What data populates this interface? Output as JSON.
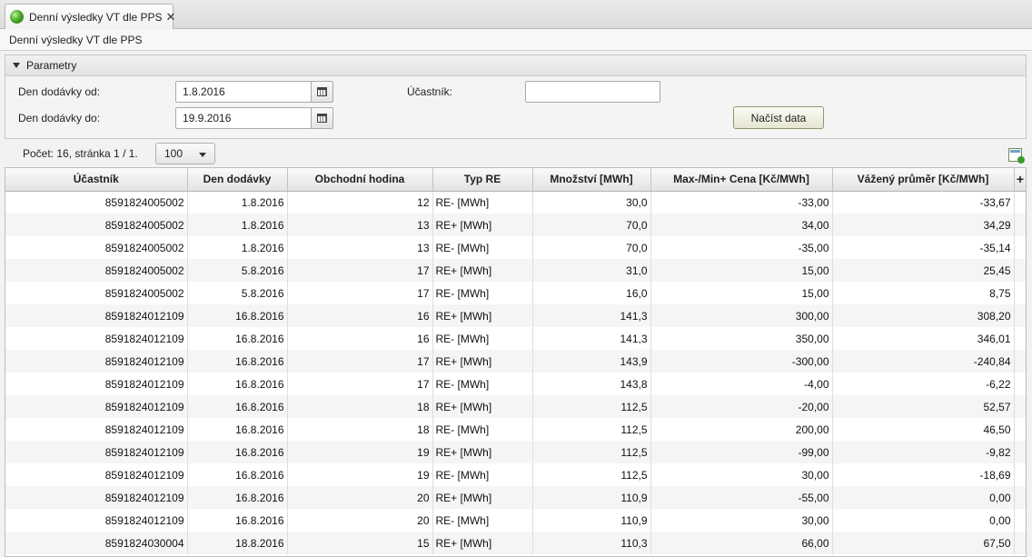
{
  "tab": {
    "title": "Denní výsledky VT dle PPS",
    "close": "✕"
  },
  "page_title": "Denní výsledky VT dle PPS",
  "params": {
    "section_label": "Parametry",
    "date_from_label": "Den dodávky od:",
    "date_from_value": "1.8.2016",
    "date_to_label": "Den dodávky do:",
    "date_to_value": "19.9.2016",
    "participant_label": "Účastník:",
    "participant_value": "",
    "load_button": "Načíst data"
  },
  "pager": {
    "summary": "Počet: 16, stránka 1 / 1.",
    "page_size": "100"
  },
  "table": {
    "columns": [
      "Účastník",
      "Den dodávky",
      "Obchodní hodina",
      "Typ RE",
      "Množství [MWh]",
      "Max-/Min+ Cena [Kč/MWh]",
      "Vážený průměr [Kč/MWh]"
    ],
    "add_column": "+",
    "rows": [
      [
        "8591824005002",
        "1.8.2016",
        "12",
        "RE- [MWh]",
        "30,0",
        "-33,00",
        "-33,67"
      ],
      [
        "8591824005002",
        "1.8.2016",
        "13",
        "RE+ [MWh]",
        "70,0",
        "34,00",
        "34,29"
      ],
      [
        "8591824005002",
        "1.8.2016",
        "13",
        "RE- [MWh]",
        "70,0",
        "-35,00",
        "-35,14"
      ],
      [
        "8591824005002",
        "5.8.2016",
        "17",
        "RE+ [MWh]",
        "31,0",
        "15,00",
        "25,45"
      ],
      [
        "8591824005002",
        "5.8.2016",
        "17",
        "RE- [MWh]",
        "16,0",
        "15,00",
        "8,75"
      ],
      [
        "8591824012109",
        "16.8.2016",
        "16",
        "RE+ [MWh]",
        "141,3",
        "300,00",
        "308,20"
      ],
      [
        "8591824012109",
        "16.8.2016",
        "16",
        "RE- [MWh]",
        "141,3",
        "350,00",
        "346,01"
      ],
      [
        "8591824012109",
        "16.8.2016",
        "17",
        "RE+ [MWh]",
        "143,9",
        "-300,00",
        "-240,84"
      ],
      [
        "8591824012109",
        "16.8.2016",
        "17",
        "RE- [MWh]",
        "143,8",
        "-4,00",
        "-6,22"
      ],
      [
        "8591824012109",
        "16.8.2016",
        "18",
        "RE+ [MWh]",
        "112,5",
        "-20,00",
        "52,57"
      ],
      [
        "8591824012109",
        "16.8.2016",
        "18",
        "RE- [MWh]",
        "112,5",
        "200,00",
        "46,50"
      ],
      [
        "8591824012109",
        "16.8.2016",
        "19",
        "RE+ [MWh]",
        "112,5",
        "-99,00",
        "-9,82"
      ],
      [
        "8591824012109",
        "16.8.2016",
        "19",
        "RE- [MWh]",
        "112,5",
        "30,00",
        "-18,69"
      ],
      [
        "8591824012109",
        "16.8.2016",
        "20",
        "RE+ [MWh]",
        "110,9",
        "-55,00",
        "0,00"
      ],
      [
        "8591824012109",
        "16.8.2016",
        "20",
        "RE- [MWh]",
        "110,9",
        "30,00",
        "0,00"
      ],
      [
        "8591824030004",
        "18.8.2016",
        "15",
        "RE+ [MWh]",
        "110,3",
        "66,00",
        "67,50"
      ]
    ]
  }
}
